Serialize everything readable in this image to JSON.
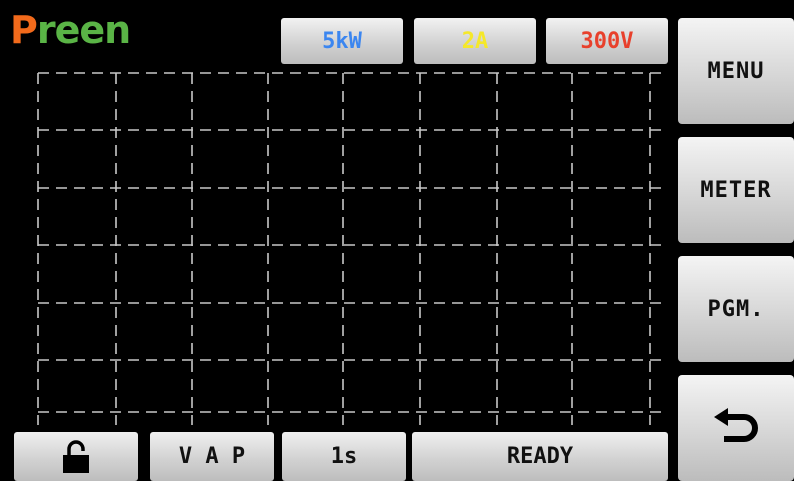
{
  "logo": {
    "letters": [
      {
        "ch": "P",
        "color": "#f26a1b"
      },
      {
        "ch": "r",
        "color": "#5ab446"
      },
      {
        "ch": "e",
        "color": "#5ab446"
      },
      {
        "ch": "e",
        "color": "#5ab446"
      },
      {
        "ch": "n",
        "color": "#5ab446"
      }
    ]
  },
  "ranges": {
    "power": {
      "label": "5kW",
      "color": "#3b86f0"
    },
    "current": {
      "label": "2A",
      "color": "#f5e82a"
    },
    "voltage": {
      "label": "300V",
      "color": "#e8402c"
    }
  },
  "side_menu": {
    "menu": "MENU",
    "meter": "METER",
    "pgm": "PGM.",
    "back_icon": "return-arrow-icon"
  },
  "bottom_bar": {
    "lock_icon": "unlock-padlock-icon",
    "vap": "V A P",
    "interval": "1s",
    "status": "READY"
  },
  "colors": {
    "grid": "#c8c8c8",
    "background": "#000000"
  }
}
